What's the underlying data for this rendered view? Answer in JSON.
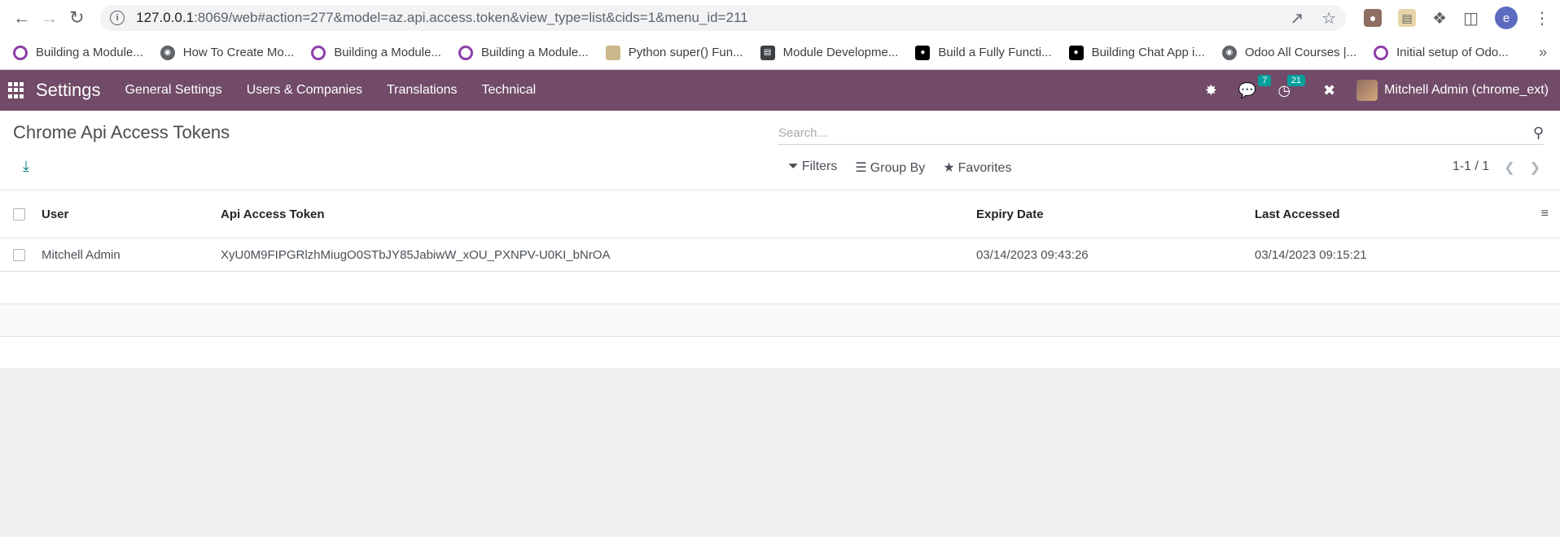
{
  "browser": {
    "url_host": "127.0.0.1",
    "url_rest": ":8069/web#action=277&model=az.api.access.token&view_type=list&cids=1&menu_id=211",
    "profile_initial": "e",
    "bookmarks": [
      {
        "label": "Building a Module...",
        "icon": "ring-icon"
      },
      {
        "label": "How To Create Mo...",
        "icon": "globe-icon"
      },
      {
        "label": "Building a Module...",
        "icon": "ring-icon"
      },
      {
        "label": "Building a Module...",
        "icon": "ring-icon"
      },
      {
        "label": "Python super() Fun...",
        "icon": "site-icon"
      },
      {
        "label": "Module Developme...",
        "icon": "doc-icon"
      },
      {
        "label": "Build a Fully Functi...",
        "icon": "medium-icon"
      },
      {
        "label": "Building Chat App i...",
        "icon": "medium-icon"
      },
      {
        "label": "Odoo All Courses |...",
        "icon": "globe-icon"
      },
      {
        "label": "Initial setup of Odo...",
        "icon": "ring-icon"
      }
    ]
  },
  "navbar": {
    "brand": "Settings",
    "menu": [
      "General Settings",
      "Users & Companies",
      "Translations",
      "Technical"
    ],
    "messages_count": "7",
    "activities_count": "21",
    "user": "Mitchell Admin (chrome_ext)",
    "accent_color": "#714b67"
  },
  "control": {
    "title": "Chrome Api Access Tokens",
    "search_placeholder": "Search...",
    "filters_label": "Filters",
    "groupby_label": "Group By",
    "favorites_label": "Favorites",
    "pager": "1-1 / 1"
  },
  "table": {
    "columns": [
      "User",
      "Api Access Token",
      "Expiry Date",
      "Last Accessed"
    ],
    "rows": [
      {
        "user": "Mitchell Admin",
        "token": "XyU0M9FIPGRlzhMiugO0STbJY85JabiwW_xOU_PXNPV-U0KI_bNrOA",
        "expiry": "03/14/2023 09:43:26",
        "last": "03/14/2023 09:15:21"
      }
    ]
  }
}
